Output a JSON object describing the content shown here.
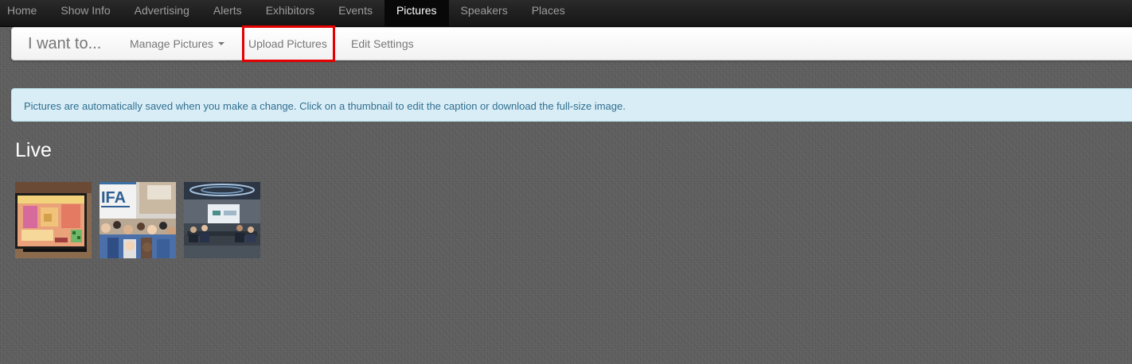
{
  "topnav": {
    "items": [
      {
        "label": "Home"
      },
      {
        "label": "Show Info"
      },
      {
        "label": "Advertising"
      },
      {
        "label": "Alerts"
      },
      {
        "label": "Exhibitors"
      },
      {
        "label": "Events"
      },
      {
        "label": "Pictures",
        "active": true
      },
      {
        "label": "Speakers"
      },
      {
        "label": "Places"
      }
    ]
  },
  "subnav": {
    "brand": "I want to...",
    "manage_pictures": "Manage Pictures",
    "upload_pictures": "Upload Pictures",
    "edit_settings": "Edit Settings",
    "highlight_color": "#e50000"
  },
  "alert": {
    "text": "Pictures are automatically saved when you make a change. Click on a thumbnail to edit the caption or download the full-size image."
  },
  "section": {
    "title": "Live"
  },
  "thumbnails": {
    "thumb_2_sign": "IFA"
  },
  "colors": {
    "topnav_bg": "#151515",
    "active_tab_bg": "#080808",
    "alert_bg": "#d9edf7",
    "alert_text": "#31708f",
    "page_bg": "#5e5e5e"
  }
}
